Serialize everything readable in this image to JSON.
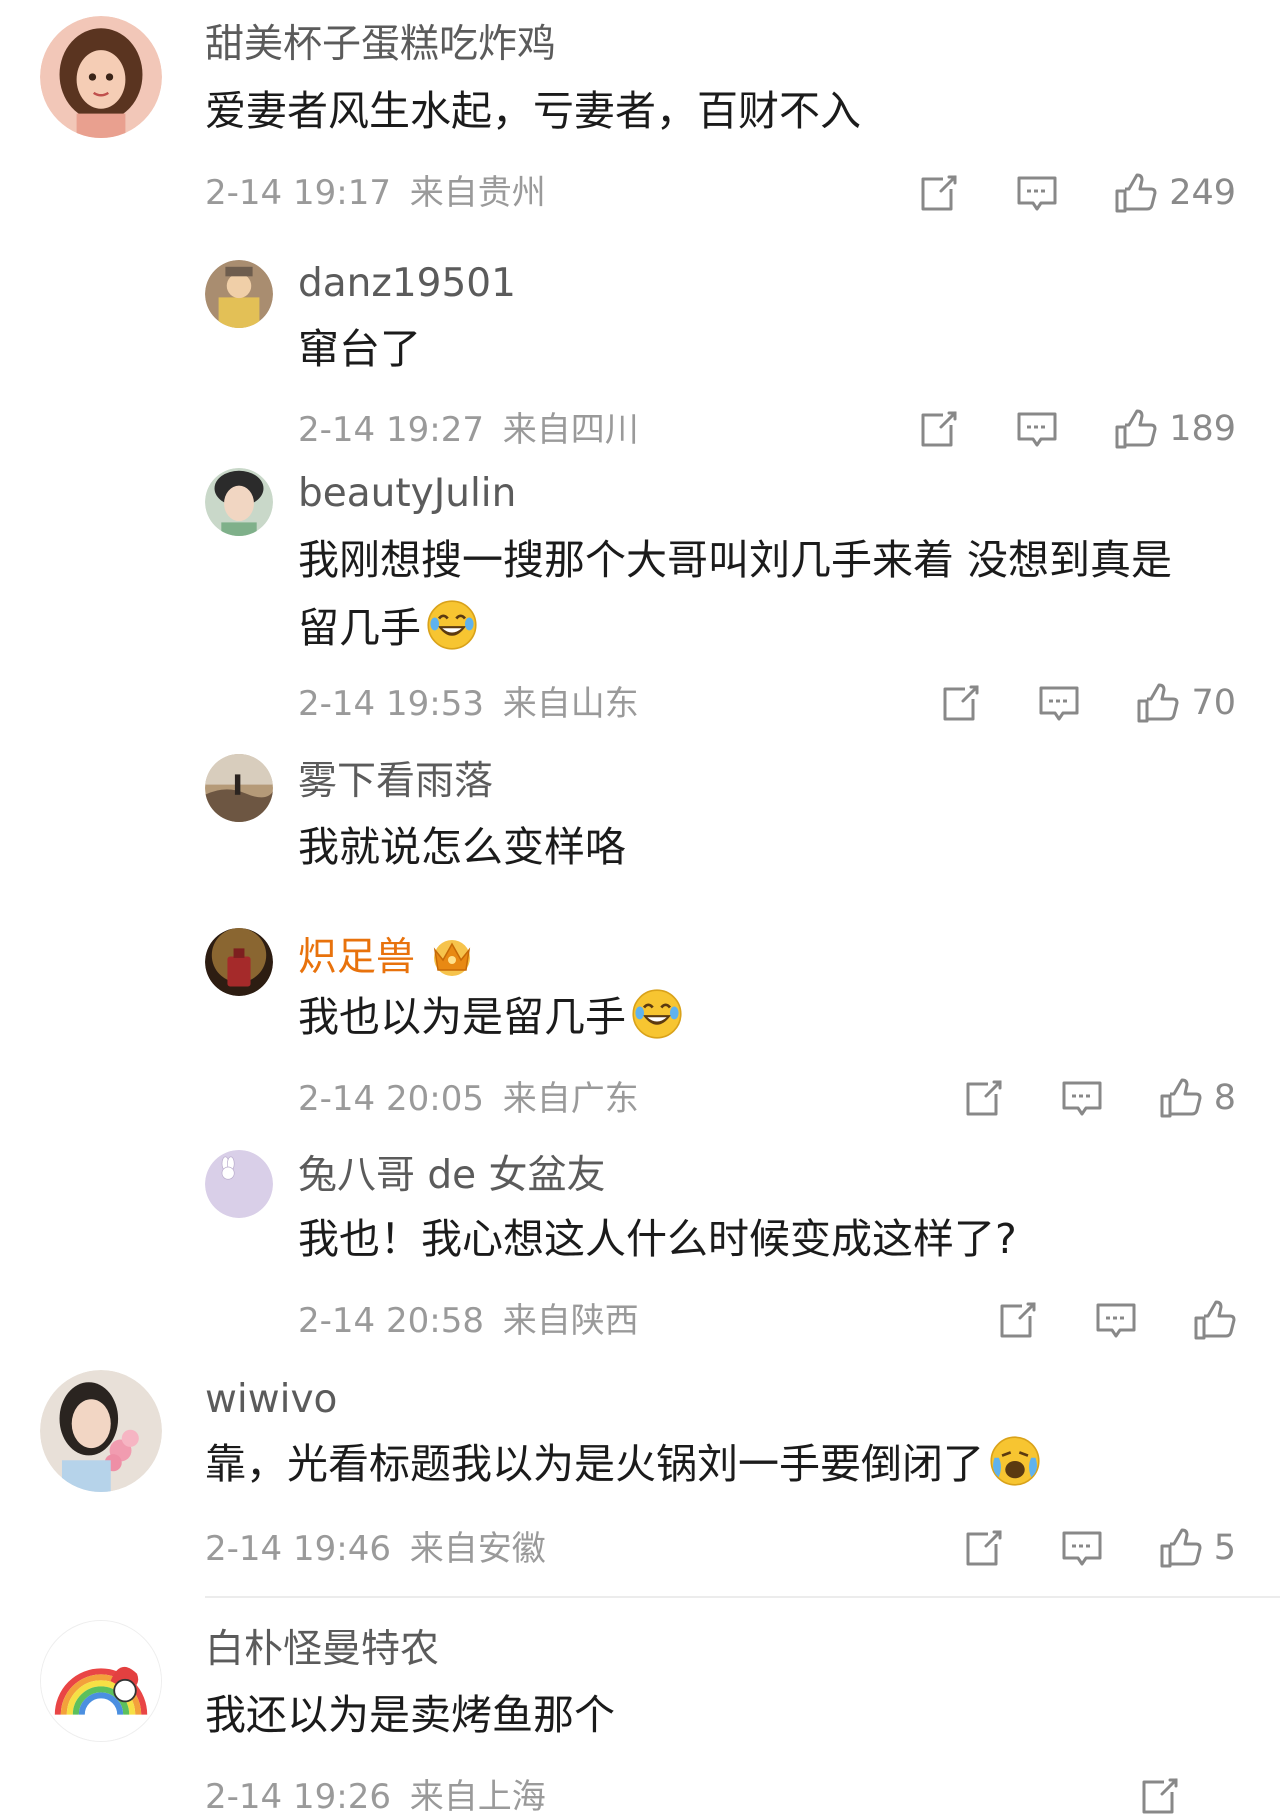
{
  "comments": [
    {
      "user": "甜美杯子蛋糕吃炸鸡",
      "text": "爱妻者风生水起，亏妻者，百财不入",
      "time": "2-14 19:17",
      "location": "来自贵州",
      "likes": "249",
      "replies": [
        {
          "user": "danz19501",
          "text": "窜台了",
          "time": "2-14 19:27",
          "location": "来自四川",
          "likes": "189"
        },
        {
          "user": "beautyJulin",
          "text_line1": "我刚想搜一搜那个大哥叫刘几手来着 没想到真是",
          "text_line2": "留几手",
          "time": "2-14 19:53",
          "location": "来自山东",
          "likes": "70",
          "emoji": "laugh-cry-emoji"
        },
        {
          "user": "雾下看雨落",
          "text": "我就说怎么变样咯"
        },
        {
          "user": "炽足兽",
          "text": "我也以为是留几手",
          "time": "2-14 20:05",
          "location": "来自广东",
          "likes": "8",
          "badge": "crown-badge-icon",
          "emoji": "laugh-cry-emoji"
        },
        {
          "user": "兔八哥 de 女盆友",
          "text": "我也！我心想这人什么时候变成这样了?",
          "time": "2-14 20:58",
          "location": "来自陕西",
          "likes": ""
        }
      ]
    },
    {
      "user": "wiwivo",
      "text": "靠，光看标题我以为是火锅刘一手要倒闭了",
      "time": "2-14 19:46",
      "location": "来自安徽",
      "likes": "5",
      "emoji": "loudly-crying-laugh-emoji"
    },
    {
      "user": "白朴怪曼特农",
      "text": "我还以为是卖烤鱼那个",
      "time": "2-14 19:26",
      "location": "来自上海"
    }
  ],
  "colors": {
    "name": "#5b5b5b",
    "vip_name": "#e8720c",
    "meta": "#9a9a9a",
    "text": "#1b1b1b"
  }
}
